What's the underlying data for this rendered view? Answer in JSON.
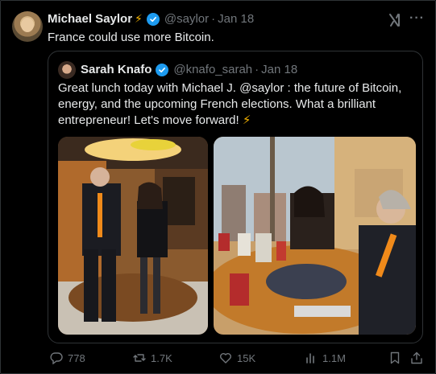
{
  "tweet": {
    "author_name": "Michael Saylor",
    "author_emoji": "⚡",
    "handle": "@saylor",
    "separator": "·",
    "date": "Jan 18",
    "text": "France could use more Bitcoin.",
    "more_icon": "···"
  },
  "quote": {
    "author_name": "Sarah Knafo",
    "handle": "@knafo_sarah",
    "separator": "·",
    "date": "Jan 18",
    "text": "Great lunch today with Michael J. @saylor : the future of Bitcoin, energy, and the upcoming French elections. What a brilliant entrepreneur! Let's move forward!",
    "text_emoji": "⚡"
  },
  "actions": {
    "replies": "778",
    "reposts": "1.7K",
    "likes": "15K",
    "views": "1.1M"
  },
  "colors": {
    "background": "#000000",
    "text": "#e7e9ea",
    "muted": "#71767b",
    "border": "#2f3336",
    "verified": "#1d9bf0",
    "bolt": "#f7b500"
  }
}
